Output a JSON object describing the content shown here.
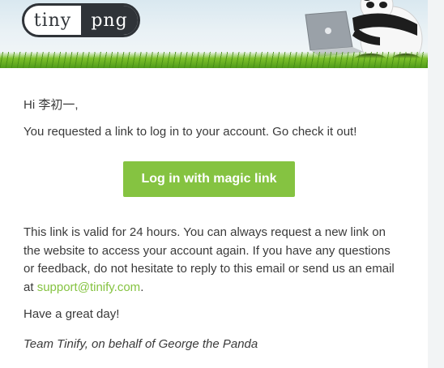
{
  "header": {
    "logo_left": "tiny",
    "logo_right": "png"
  },
  "email": {
    "greeting": "Hi 李初一,",
    "intro": "You requested a link to log in to your account. Go check it out!",
    "cta_label": "Log in with magic link",
    "body_text": "This link is valid for 24 hours. You can always request a new link on the website to access your account again. If you have any questions or feedback, do not hesitate to reply to this email or send us an email at ",
    "support_email": "support@tinify.com",
    "body_end": ".",
    "closing": "Have a great day!",
    "signature": "Team Tinify, on behalf of George the Panda"
  },
  "colors": {
    "accent_green": "#85c341",
    "logo_dark": "#2f3338",
    "text": "#3a3a3a"
  }
}
